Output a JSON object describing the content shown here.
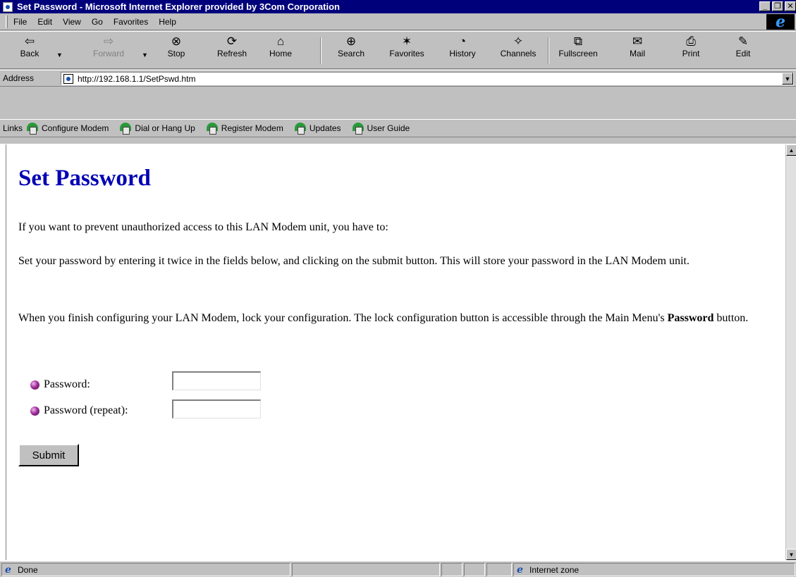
{
  "window": {
    "title": "Set Password - Microsoft Internet Explorer provided by 3Com Corporation",
    "controls": {
      "minimize": "_",
      "maximize": "❐",
      "close": "✕"
    }
  },
  "menu": {
    "items": [
      "File",
      "Edit",
      "View",
      "Go",
      "Favorites",
      "Help"
    ]
  },
  "toolbar": {
    "back": "Back",
    "forward": "Forward",
    "stop": "Stop",
    "refresh": "Refresh",
    "home": "Home",
    "search": "Search",
    "favorites": "Favorites",
    "history": "History",
    "channels": "Channels",
    "fullscreen": "Fullscreen",
    "mail": "Mail",
    "print": "Print",
    "edit": "Edit"
  },
  "address": {
    "label": "Address",
    "url": "http://192.168.1.1/SetPswd.htm"
  },
  "links": {
    "label": "Links",
    "items": [
      "Configure Modem",
      "Dial or Hang Up",
      "Register Modem",
      "Updates",
      "User Guide"
    ]
  },
  "page": {
    "heading": "Set Password",
    "para1": "If you want to prevent unauthorized access to this LAN Modem unit, you have to:",
    "para2": "Set your password by entering it twice in the fields below, and clicking on the submit button. This will store your password in the LAN Modem unit.",
    "para3_before": "When you finish configuring your LAN Modem, lock your configuration. The lock configuration button is accessible through the Main Menu's ",
    "para3_bold": "Password",
    "para3_after": " button.",
    "password_label": "Password:",
    "password_repeat_label": "Password (repeat):",
    "password_value": "",
    "password_repeat_value": "",
    "submit_label": "Submit"
  },
  "status": {
    "text": "Done",
    "zone": "Internet zone"
  },
  "colors": {
    "titlebar": "#00007b",
    "heading": "#0000b4",
    "chrome": "#c0c0c0"
  }
}
